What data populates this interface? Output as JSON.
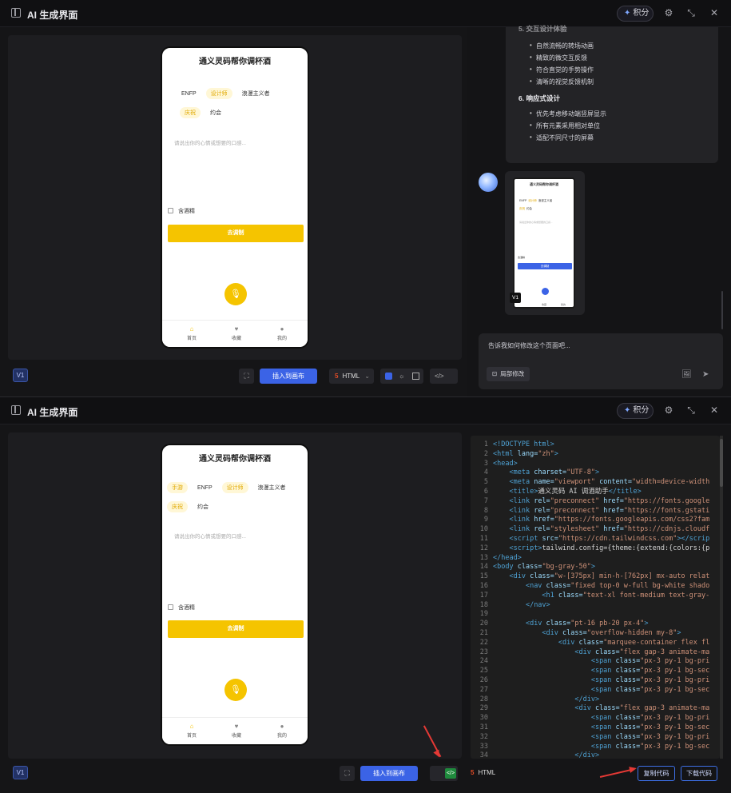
{
  "app": {
    "title": "AI 生成界面",
    "credits": "积分"
  },
  "phone": {
    "title": "通义灵码帮你调杯酒",
    "tags_row1_top": [
      "ENFP",
      "设计师",
      "浪漫主义者"
    ],
    "tags_row2_top": [
      "庆祝",
      "约会"
    ],
    "tags_row1_bottom": [
      "手游",
      "ENFP",
      "设计师",
      "浪漫主义者"
    ],
    "tags_row2_bottom": [
      "庆祝",
      "约会"
    ],
    "placeholder": "请说出你的心情或想要的口感...",
    "checkbox_label": "含酒精",
    "mix_button": "去调制",
    "nav": [
      "首页",
      "收藏",
      "我的"
    ]
  },
  "toolbar": {
    "version": "V1",
    "insert_label": "插入到画布",
    "format_label": "HTML"
  },
  "chat": {
    "truncated_heading": "5. 交互设计体验",
    "list1": [
      "自然流畅的转场动画",
      "精致的微交互反馈",
      "符合直觉的手势操作",
      "清晰的视觉反馈机制"
    ],
    "heading6": "6. 响应式设计",
    "list2": [
      "优先考虑移动端竖屏显示",
      "所有元素采用相对单位",
      "适配不同尺寸的屏幕"
    ],
    "thumb_version": "V1",
    "input_placeholder": "告诉我如何修改这个页面吧...",
    "local_edit": "局部修改"
  },
  "code_panel": {
    "copy_label": "复制代码",
    "download_label": "下载代码",
    "lines": [
      [
        {
          "c": "tg",
          "t": "<!DOCTYPE html>"
        }
      ],
      [
        {
          "c": "tg",
          "t": "<html "
        },
        {
          "c": "at",
          "t": "lang="
        },
        {
          "c": "st",
          "t": "\"zh\""
        },
        {
          "c": "tg",
          "t": ">"
        }
      ],
      [
        {
          "c": "tg",
          "t": "<head>"
        }
      ],
      [
        {
          "c": "tx",
          "t": "    "
        },
        {
          "c": "tg",
          "t": "<meta "
        },
        {
          "c": "at",
          "t": "charset="
        },
        {
          "c": "st",
          "t": "\"UTF-8\""
        },
        {
          "c": "tg",
          "t": ">"
        }
      ],
      [
        {
          "c": "tx",
          "t": "    "
        },
        {
          "c": "tg",
          "t": "<meta "
        },
        {
          "c": "at",
          "t": "name="
        },
        {
          "c": "st",
          "t": "\"viewport\" "
        },
        {
          "c": "at",
          "t": "content="
        },
        {
          "c": "st",
          "t": "\"width=device-width"
        }
      ],
      [
        {
          "c": "tx",
          "t": "    "
        },
        {
          "c": "tg",
          "t": "<title>"
        },
        {
          "c": "tx",
          "t": "通义灵码 AI 调酒助手"
        },
        {
          "c": "tg",
          "t": "</title>"
        }
      ],
      [
        {
          "c": "tx",
          "t": "    "
        },
        {
          "c": "tg",
          "t": "<link "
        },
        {
          "c": "at",
          "t": "rel="
        },
        {
          "c": "st",
          "t": "\"preconnect\" "
        },
        {
          "c": "at",
          "t": "href="
        },
        {
          "c": "st",
          "t": "\"https://fonts.google"
        }
      ],
      [
        {
          "c": "tx",
          "t": "    "
        },
        {
          "c": "tg",
          "t": "<link "
        },
        {
          "c": "at",
          "t": "rel="
        },
        {
          "c": "st",
          "t": "\"preconnect\" "
        },
        {
          "c": "at",
          "t": "href="
        },
        {
          "c": "st",
          "t": "\"https://fonts.gstati"
        }
      ],
      [
        {
          "c": "tx",
          "t": "    "
        },
        {
          "c": "tg",
          "t": "<link "
        },
        {
          "c": "at",
          "t": "href="
        },
        {
          "c": "st",
          "t": "\"https://fonts.googleapis.com/css2?fam"
        }
      ],
      [
        {
          "c": "tx",
          "t": "    "
        },
        {
          "c": "tg",
          "t": "<link "
        },
        {
          "c": "at",
          "t": "rel="
        },
        {
          "c": "st",
          "t": "\"stylesheet\" "
        },
        {
          "c": "at",
          "t": "href="
        },
        {
          "c": "st",
          "t": "\"https://cdnjs.cloudf"
        }
      ],
      [
        {
          "c": "tx",
          "t": "    "
        },
        {
          "c": "tg",
          "t": "<script "
        },
        {
          "c": "at",
          "t": "src="
        },
        {
          "c": "st",
          "t": "\"https://cdn.tailwindcss.com\""
        },
        {
          "c": "tg",
          "t": "></scrip"
        }
      ],
      [
        {
          "c": "tx",
          "t": "    "
        },
        {
          "c": "tg",
          "t": "<script>"
        },
        {
          "c": "tx",
          "t": "tailwind.config={theme:{extend:{colors:{p"
        }
      ],
      [
        {
          "c": "tg",
          "t": "</head>"
        }
      ],
      [
        {
          "c": "tg",
          "t": "<body "
        },
        {
          "c": "at",
          "t": "class="
        },
        {
          "c": "st",
          "t": "\"bg-gray-50\""
        },
        {
          "c": "tg",
          "t": ">"
        }
      ],
      [
        {
          "c": "tx",
          "t": "    "
        },
        {
          "c": "tg",
          "t": "<div "
        },
        {
          "c": "at",
          "t": "class="
        },
        {
          "c": "st",
          "t": "\"w-[375px] min-h-[762px] mx-auto relat"
        }
      ],
      [
        {
          "c": "tx",
          "t": "        "
        },
        {
          "c": "tg",
          "t": "<nav "
        },
        {
          "c": "at",
          "t": "class="
        },
        {
          "c": "st",
          "t": "\"fixed top-0 w-full bg-white shado"
        }
      ],
      [
        {
          "c": "tx",
          "t": "            "
        },
        {
          "c": "tg",
          "t": "<h1 "
        },
        {
          "c": "at",
          "t": "class="
        },
        {
          "c": "st",
          "t": "\"text-xl font-medium text-gray-"
        }
      ],
      [
        {
          "c": "tx",
          "t": "        "
        },
        {
          "c": "tg",
          "t": "</nav>"
        }
      ],
      [
        {
          "c": "tx",
          "t": ""
        }
      ],
      [
        {
          "c": "tx",
          "t": "        "
        },
        {
          "c": "tg",
          "t": "<div "
        },
        {
          "c": "at",
          "t": "class="
        },
        {
          "c": "st",
          "t": "\"pt-16 pb-20 px-4\""
        },
        {
          "c": "tg",
          "t": ">"
        }
      ],
      [
        {
          "c": "tx",
          "t": "            "
        },
        {
          "c": "tg",
          "t": "<div "
        },
        {
          "c": "at",
          "t": "class="
        },
        {
          "c": "st",
          "t": "\"overflow-hidden my-8\""
        },
        {
          "c": "tg",
          "t": ">"
        }
      ],
      [
        {
          "c": "tx",
          "t": "                "
        },
        {
          "c": "tg",
          "t": "<div "
        },
        {
          "c": "at",
          "t": "class="
        },
        {
          "c": "st",
          "t": "\"marquee-container flex fl"
        }
      ],
      [
        {
          "c": "tx",
          "t": "                    "
        },
        {
          "c": "tg",
          "t": "<div "
        },
        {
          "c": "at",
          "t": "class="
        },
        {
          "c": "st",
          "t": "\"flex gap-3 animate-ma"
        }
      ],
      [
        {
          "c": "tx",
          "t": "                        "
        },
        {
          "c": "tg",
          "t": "<span "
        },
        {
          "c": "at",
          "t": "class="
        },
        {
          "c": "st",
          "t": "\"px-3 py-1 bg-pri"
        }
      ],
      [
        {
          "c": "tx",
          "t": "                        "
        },
        {
          "c": "tg",
          "t": "<span "
        },
        {
          "c": "at",
          "t": "class="
        },
        {
          "c": "st",
          "t": "\"px-3 py-1 bg-sec"
        }
      ],
      [
        {
          "c": "tx",
          "t": "                        "
        },
        {
          "c": "tg",
          "t": "<span "
        },
        {
          "c": "at",
          "t": "class="
        },
        {
          "c": "st",
          "t": "\"px-3 py-1 bg-pri"
        }
      ],
      [
        {
          "c": "tx",
          "t": "                        "
        },
        {
          "c": "tg",
          "t": "<span "
        },
        {
          "c": "at",
          "t": "class="
        },
        {
          "c": "st",
          "t": "\"px-3 py-1 bg-sec"
        }
      ],
      [
        {
          "c": "tx",
          "t": "                    "
        },
        {
          "c": "tg",
          "t": "</div>"
        }
      ],
      [
        {
          "c": "tx",
          "t": "                    "
        },
        {
          "c": "tg",
          "t": "<div "
        },
        {
          "c": "at",
          "t": "class="
        },
        {
          "c": "st",
          "t": "\"flex gap-3 animate-ma"
        }
      ],
      [
        {
          "c": "tx",
          "t": "                        "
        },
        {
          "c": "tg",
          "t": "<span "
        },
        {
          "c": "at",
          "t": "class="
        },
        {
          "c": "st",
          "t": "\"px-3 py-1 bg-pri"
        }
      ],
      [
        {
          "c": "tx",
          "t": "                        "
        },
        {
          "c": "tg",
          "t": "<span "
        },
        {
          "c": "at",
          "t": "class="
        },
        {
          "c": "st",
          "t": "\"px-3 py-1 bg-sec"
        }
      ],
      [
        {
          "c": "tx",
          "t": "                        "
        },
        {
          "c": "tg",
          "t": "<span "
        },
        {
          "c": "at",
          "t": "class="
        },
        {
          "c": "st",
          "t": "\"px-3 py-1 bg-pri"
        }
      ],
      [
        {
          "c": "tx",
          "t": "                        "
        },
        {
          "c": "tg",
          "t": "<span "
        },
        {
          "c": "at",
          "t": "class="
        },
        {
          "c": "st",
          "t": "\"px-3 py-1 bg-sec"
        }
      ],
      [
        {
          "c": "tx",
          "t": "                    "
        },
        {
          "c": "tg",
          "t": "</div>"
        }
      ]
    ]
  }
}
